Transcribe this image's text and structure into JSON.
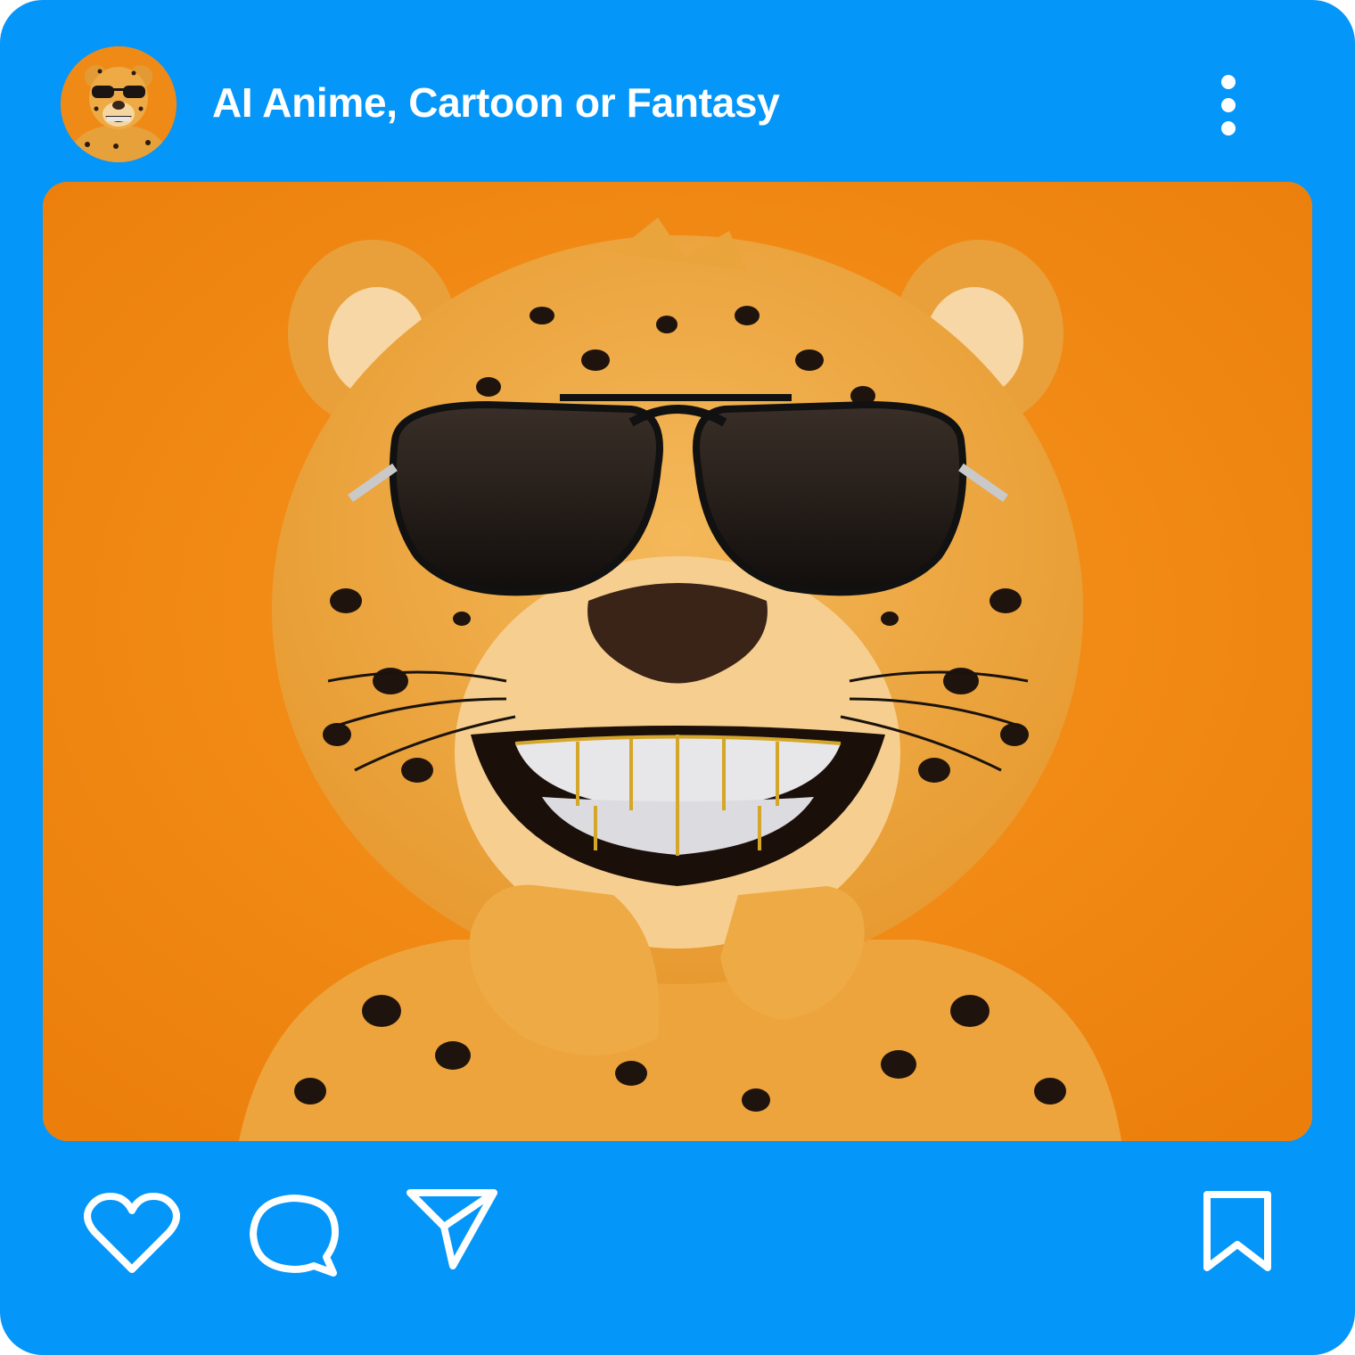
{
  "post": {
    "account_name": "AI Anime, Cartoon or Fantasy",
    "avatar": "cheetah-avatar",
    "image": "cheetah-with-sunglasses-and-diamond-grillz"
  },
  "header": {
    "more_icon": "more-vertical-icon"
  },
  "actions": {
    "like_icon": "heart-icon",
    "comment_icon": "comment-icon",
    "share_icon": "send-icon",
    "save_icon": "bookmark-icon"
  },
  "colors": {
    "card_background": "#0496f9",
    "photo_background": "#f08a16",
    "icon_color": "#ffffff"
  }
}
